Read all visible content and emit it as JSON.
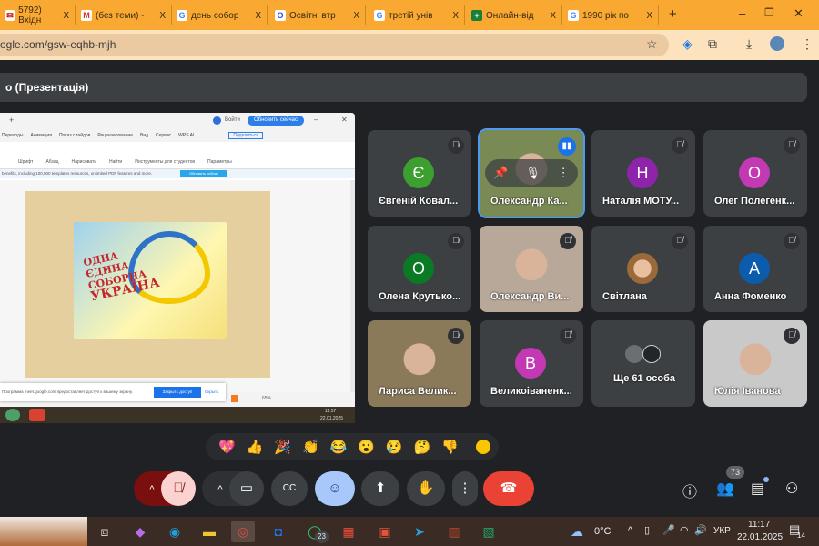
{
  "browser": {
    "tabs": [
      {
        "label": "5792) Вхідн",
        "icon": "mail-icon"
      },
      {
        "label": "(без теми) -",
        "icon": "gmail-icon"
      },
      {
        "label": "день собор",
        "icon": "google-icon"
      },
      {
        "label": "Освітні втр",
        "icon": "app-icon"
      },
      {
        "label": "третій унів",
        "icon": "google-icon"
      },
      {
        "label": "Онлайн-від",
        "icon": "sheets-icon"
      },
      {
        "label": "1990 рік по",
        "icon": "google-icon"
      }
    ],
    "close_glyph": "X",
    "new_tab": "+",
    "url": "ogle.com/gsw-eqhb-mjh"
  },
  "meeting": {
    "title": "о (Презентація)",
    "presentation": {
      "login": "Войти",
      "update_btn": "Обновить сейчас",
      "menu": [
        "Переходы",
        "Анимация",
        "Показ слайдов",
        "Рецензирование",
        "Вид",
        "Сервис",
        "WPS AI"
      ],
      "share": "Поделиться",
      "tools": [
        "Шрифт",
        "Абзац",
        "Нарисовать",
        "Найти",
        "Инструменты для студентов",
        "Параметры"
      ],
      "banner": "benefits, including 100,000 templates resources, unlimited PDF features and more.",
      "banner_btn": "Обновить сейчас",
      "slide_text": [
        "ОДНА",
        "ЄДИНА",
        "СОБОРНА",
        "УКРАЇНА"
      ],
      "share_notice": "Программа meet.google.com предоставляет доступ к вашему экрану.",
      "stop_share": "Закрыть доступ",
      "hide": "Скрыть",
      "zoom": "65%",
      "clock_time": "11:57",
      "clock_date": "22.01.2025"
    },
    "participants": [
      {
        "name": "Євгеній Ковал...",
        "initial": "Є",
        "color": "#3c9f2f",
        "muted": true
      },
      {
        "name": "Олександр Ка...",
        "video": true,
        "speaking": true,
        "bg": "#7a8a55"
      },
      {
        "name": "Наталія МОТУ...",
        "initial": "Н",
        "color": "#8e24aa",
        "muted": true
      },
      {
        "name": "Олег Полегенк...",
        "initial": "О",
        "color": "#c239b3",
        "muted": true
      },
      {
        "name": "Олена Крутько...",
        "initial": "О",
        "color": "#0b7a25",
        "muted": true
      },
      {
        "name": "Олександр Ви...",
        "video": true,
        "muted": true,
        "bg": "#b8a89a"
      },
      {
        "name": "Світлана",
        "photo": true,
        "muted": true
      },
      {
        "name": "Анна Фоменко",
        "initial": "А",
        "color": "#0b5cad",
        "muted": true
      },
      {
        "name": "Лариса Велик...",
        "video": true,
        "muted": true,
        "bg": "#8a7a5a"
      },
      {
        "name": "Великоіваненк...",
        "initial": "В",
        "color": "#c239b3",
        "muted": true
      },
      {
        "name": "Ще 61 особа",
        "group": true
      },
      {
        "name": "Юлія Іванова",
        "video": true,
        "muted": true,
        "bg": "#c9c9c9"
      }
    ],
    "reactions": [
      "💖",
      "👍",
      "🎉",
      "👏",
      "😂",
      "😮",
      "😢",
      "🤔",
      "👎"
    ],
    "participants_count": "73"
  },
  "taskbar": {
    "temperature": "0°C",
    "language": "УКР",
    "time": "11:17",
    "date": "22.01.2025",
    "whatsapp_badge": "23",
    "notifications": "14"
  }
}
